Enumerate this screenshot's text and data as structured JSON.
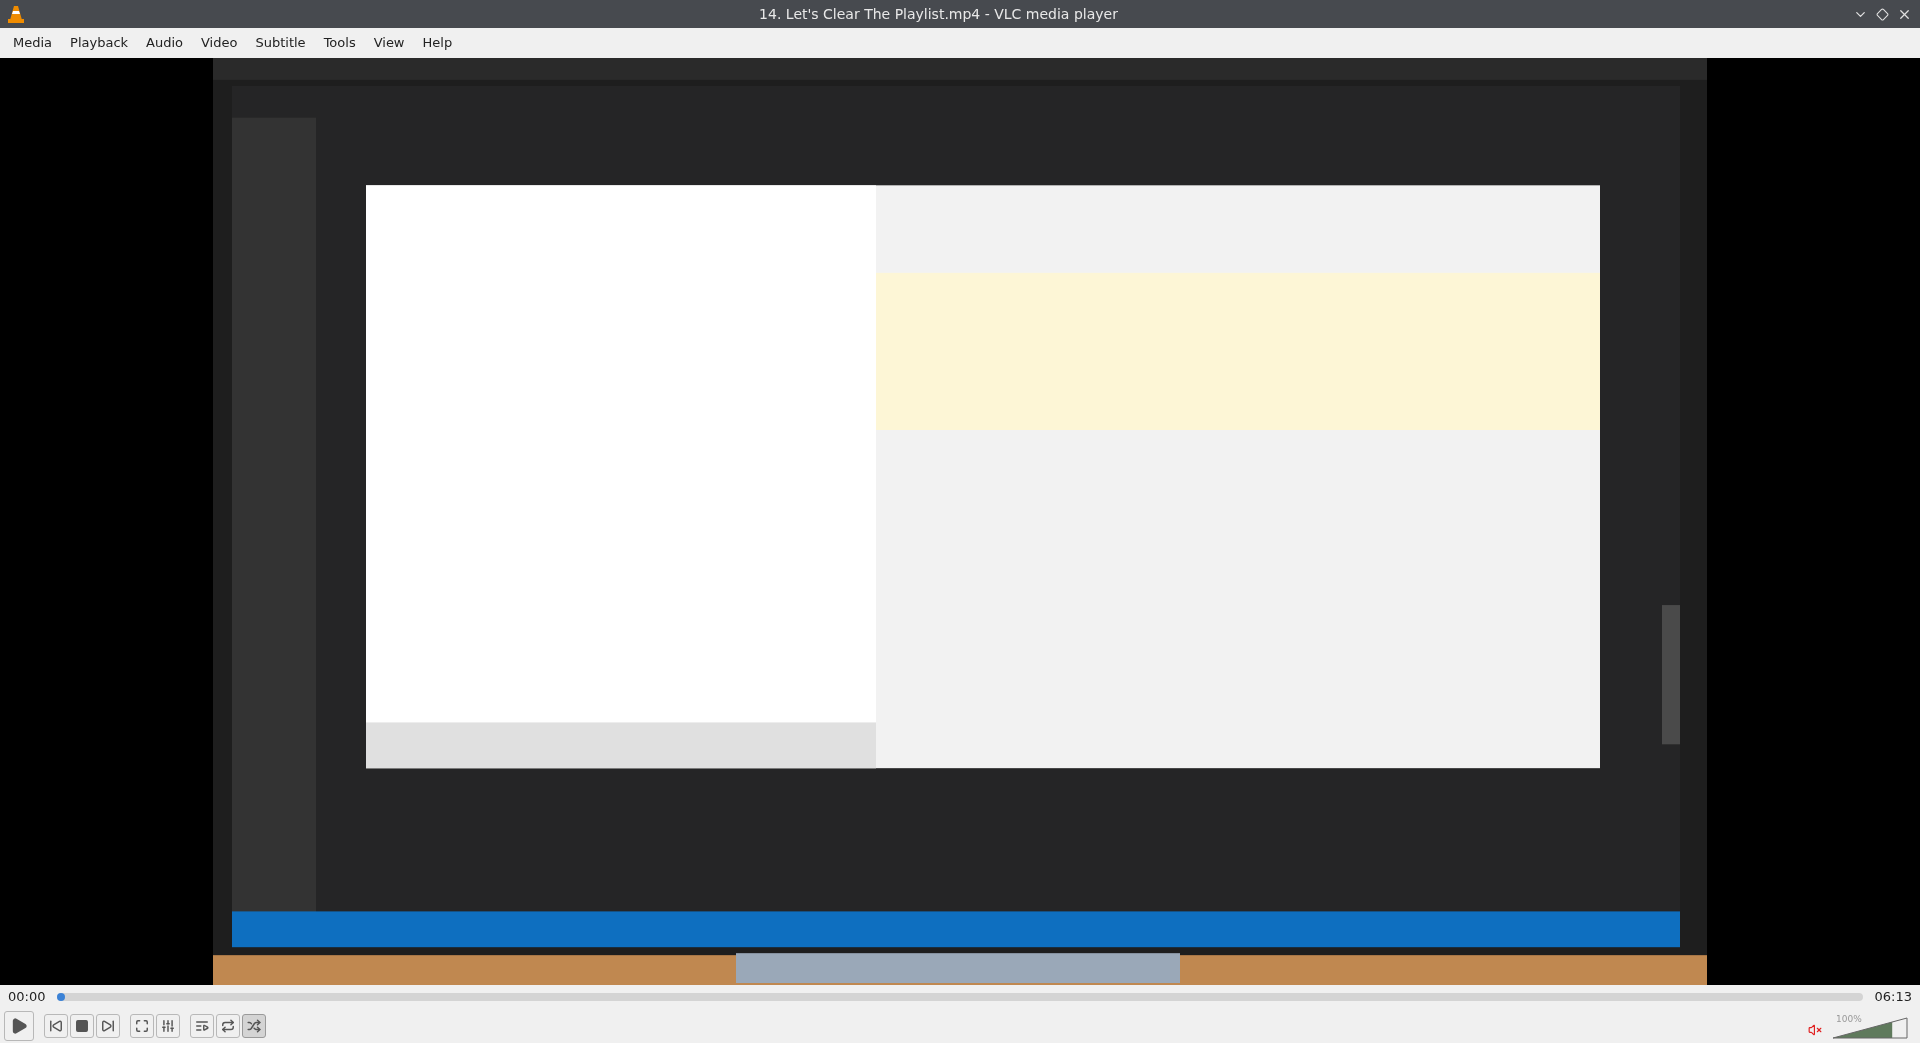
{
  "window": {
    "title": "14. Let's Clear The Playlist.mp4 - VLC media player"
  },
  "menu": [
    "Media",
    "Playback",
    "Audio",
    "Video",
    "Subtitle",
    "Tools",
    "View",
    "Help"
  ],
  "video": {
    "kind": "picture"
  },
  "seek": {
    "elapsed": "00:00",
    "total": "06:13",
    "level": 0.004
  },
  "control_groups": [
    [
      {
        "kind": "play"
      }
    ],
    [
      {
        "kind": "previous"
      },
      {
        "kind": "stop"
      },
      {
        "kind": "next"
      }
    ],
    [
      {
        "kind": "fullscreen"
      },
      {
        "kind": "extended-settings"
      }
    ],
    [
      {
        "kind": "playlist"
      },
      {
        "kind": "loop",
        "selected": false
      },
      {
        "kind": "shuffle",
        "selected": true
      }
    ]
  ],
  "volume": {
    "muted": true,
    "level": 0.8,
    "reading": "100%"
  }
}
